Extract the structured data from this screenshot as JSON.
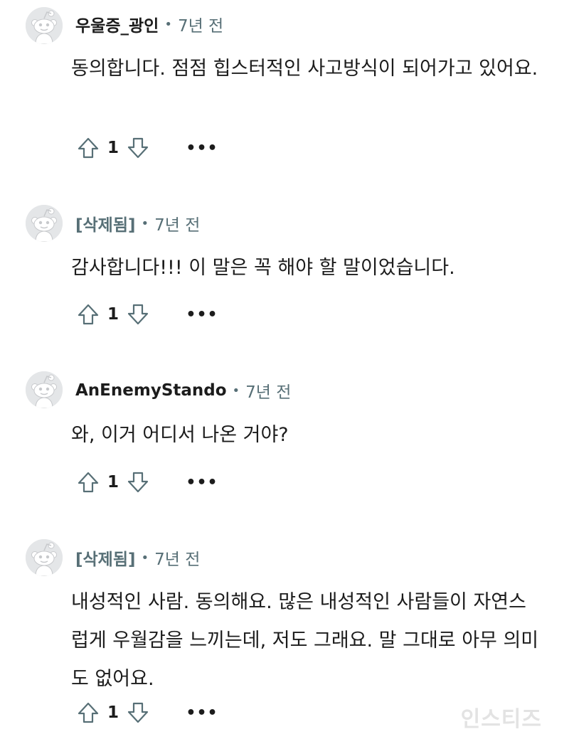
{
  "comments": [
    {
      "author": "우울증_광인",
      "time": "7년 전",
      "body": "동의합니다. 점점 힙스터적인 사고방식이 되어가고 있어요.",
      "score": "1"
    },
    {
      "author": "[삭제됨]",
      "time": "7년 전",
      "body": "감사합니다!!! 이 말은 꼭 해야 할 말이었습니다.",
      "score": "1"
    },
    {
      "author": "AnEnemyStando",
      "time": "7년 전",
      "body": "와, 이거 어디서 나온 거야?",
      "score": "1"
    },
    {
      "author": "[삭제됨]",
      "time": "7년 전",
      "body": "내성적인 사람. 동의해요. 많은 내성적인 사람들이 자연스럽게 우월감을 느끼는데, 저도 그래요. 말 그대로 아무 의미도 없어요.",
      "score": "1"
    }
  ],
  "separator": "•",
  "more_label": "•••",
  "watermark": "인스티즈",
  "icons": {
    "avatar": "snoo-avatar-icon",
    "upvote": "upvote-arrow-icon",
    "downvote": "downvote-arrow-icon",
    "more": "more-options-icon"
  }
}
